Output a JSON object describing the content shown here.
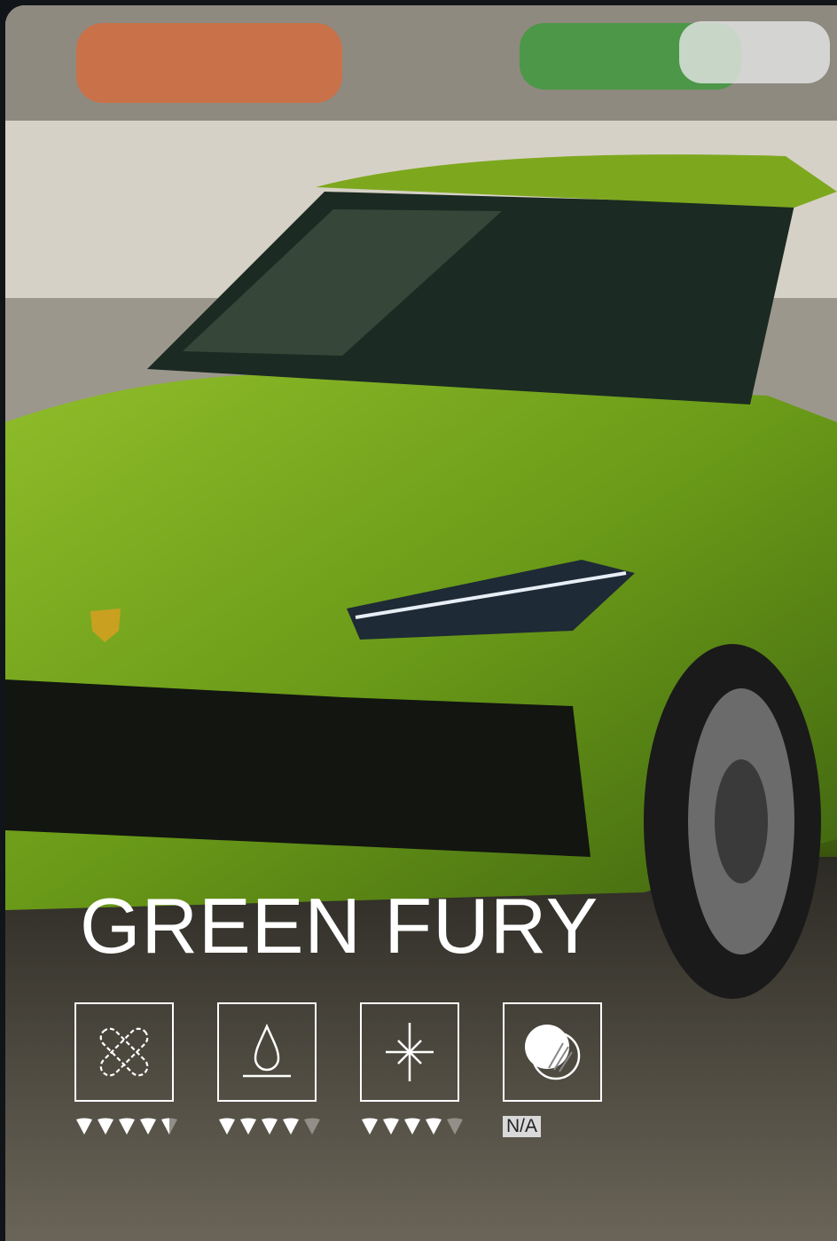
{
  "product": {
    "title": "GREEN FURY"
  },
  "ratings": [
    {
      "icon": "bandage-icon",
      "level": 4.5,
      "max": 5,
      "label": ""
    },
    {
      "icon": "water-drop-icon",
      "level": 4,
      "max": 5,
      "label": ""
    },
    {
      "icon": "sparkle-icon",
      "level": 4,
      "max": 5,
      "label": ""
    },
    {
      "icon": "coverage-icon",
      "level": null,
      "max": 5,
      "label": "N/A"
    }
  ],
  "colors": {
    "accent": "#ffffff",
    "na_badge": "#d9d9d9"
  }
}
